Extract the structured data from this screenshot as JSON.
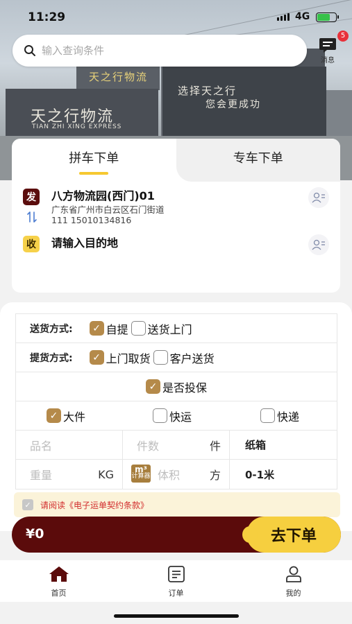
{
  "status_bar": {
    "time": "11:29",
    "network": "4G"
  },
  "search": {
    "placeholder": "输入查询条件"
  },
  "messages": {
    "label": "消息",
    "badge": "5"
  },
  "hero": {
    "sign_top": "天之行物流",
    "sign_main": "天之行物流",
    "sign_en": "TIAN ZHI XING EXPRESS",
    "slogan_1": "选择天之行",
    "slogan_2": "您会更成功"
  },
  "tabs": [
    {
      "label": "拼车下单",
      "active": true
    },
    {
      "label": "专车下单",
      "active": false
    }
  ],
  "sender": {
    "tag": "发",
    "name": "八方物流园(西门)01",
    "address": "广东省广州市白云区石门街道",
    "contact": "111  15010134816"
  },
  "receiver": {
    "tag": "收",
    "placeholder": "请输入目的地"
  },
  "delivery": {
    "label": "送货方式:",
    "options": [
      {
        "label": "自提",
        "checked": true
      },
      {
        "label": "送货上门",
        "checked": false
      }
    ]
  },
  "pickup": {
    "label": "提货方式:",
    "options": [
      {
        "label": "上门取货",
        "checked": true
      },
      {
        "label": "客户送货",
        "checked": false
      }
    ]
  },
  "insurance": {
    "label": "是否投保",
    "checked": true
  },
  "cargo_type": [
    {
      "label": "大件",
      "checked": true
    },
    {
      "label": "快运",
      "checked": false
    },
    {
      "label": "快递",
      "checked": false
    }
  ],
  "goods": {
    "name_placeholder": "品名",
    "count_placeholder": "件数",
    "count_unit": "件",
    "package": "纸箱",
    "weight_placeholder": "重量",
    "weight_unit": "KG",
    "calc_label": "计算器",
    "calc_unit": "m³",
    "volume_placeholder": "体积",
    "volume_unit": "方",
    "volume_range": "0-1米"
  },
  "agreement": {
    "text": "请阅读《电子运单契约条款》",
    "checked": false
  },
  "order": {
    "price": "¥0",
    "submit_label": "去下单"
  },
  "tabbar": [
    {
      "label": "首页",
      "icon": "home-icon"
    },
    {
      "label": "订单",
      "icon": "orders-icon"
    },
    {
      "label": "我的",
      "icon": "profile-icon"
    }
  ],
  "colors": {
    "brand_dark": "#5b0b0b",
    "accent_yellow": "#f6cf3f",
    "check_gold": "#b58a4a"
  }
}
